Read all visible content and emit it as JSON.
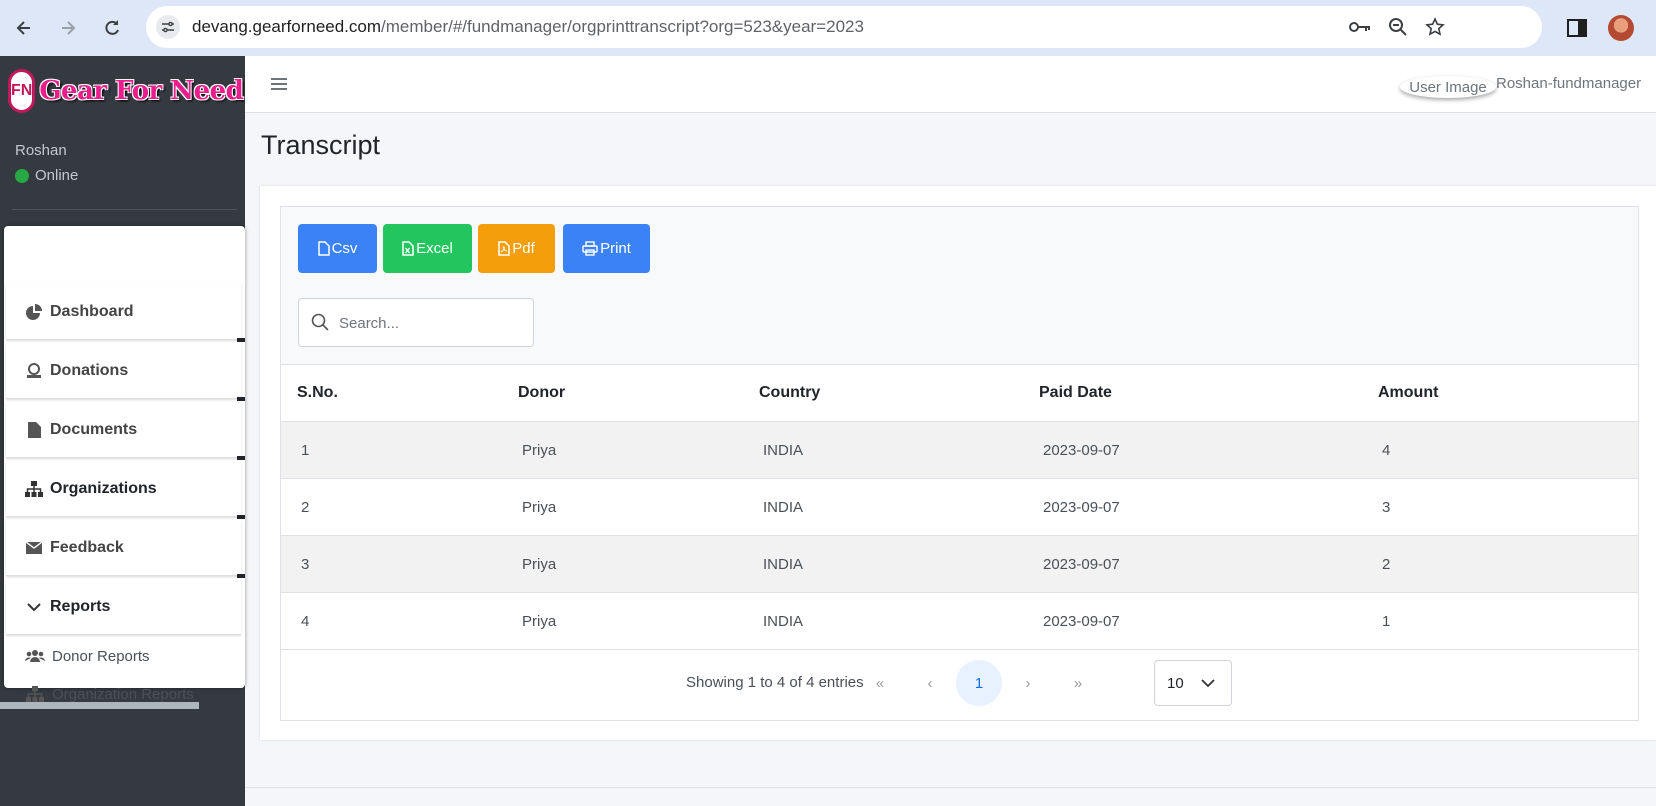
{
  "browser": {
    "url_domain": "devang.gearforneed.com",
    "url_path": "/member/#/fundmanager/orgprinttranscript?org=523&year=2023"
  },
  "sidebar": {
    "brand": "Gear For Need",
    "brand_mark": "FN",
    "user_name": "Roshan",
    "user_status": "Online",
    "items": [
      {
        "label": "Dashboard",
        "icon": "pie-chart-icon"
      },
      {
        "label": "Donations",
        "icon": "donate-icon"
      },
      {
        "label": "Documents",
        "icon": "file-icon"
      },
      {
        "label": "Organizations",
        "icon": "sitemap-icon"
      },
      {
        "label": "Feedback",
        "icon": "envelope-icon"
      },
      {
        "label": "Reports",
        "icon": "chevron-down-icon"
      }
    ],
    "sub_items": [
      {
        "label": "Donor Reports",
        "icon": "users-icon"
      },
      {
        "label": "Organization Reports",
        "icon": "sitemap-icon"
      }
    ]
  },
  "topbar": {
    "user_image_alt": "User Image",
    "user_label": "Roshan-fundmanager"
  },
  "page": {
    "title": "Transcript"
  },
  "export": {
    "csv": "Csv",
    "excel": "Excel",
    "pdf": "Pdf",
    "print": "Print"
  },
  "colors": {
    "csv": "#3b82f6",
    "excel": "#22c55e",
    "pdf": "#f59e0b",
    "print": "#3b82f6"
  },
  "search": {
    "placeholder": "Search..."
  },
  "table": {
    "headers": [
      "S.No.",
      "Donor",
      "Country",
      "Paid Date",
      "Amount"
    ],
    "rows": [
      [
        "1",
        "Priya",
        "INDIA",
        "2023-09-07",
        "4"
      ],
      [
        "2",
        "Priya",
        "INDIA",
        "2023-09-07",
        "3"
      ],
      [
        "3",
        "Priya",
        "INDIA",
        "2023-09-07",
        "2"
      ],
      [
        "4",
        "Priya",
        "INDIA",
        "2023-09-07",
        "1"
      ]
    ]
  },
  "pagination": {
    "info": "Showing 1 to 4 of 4 entries",
    "first": "«",
    "prev": "‹",
    "current": "1",
    "next": "›",
    "last": "»",
    "page_size": "10"
  }
}
